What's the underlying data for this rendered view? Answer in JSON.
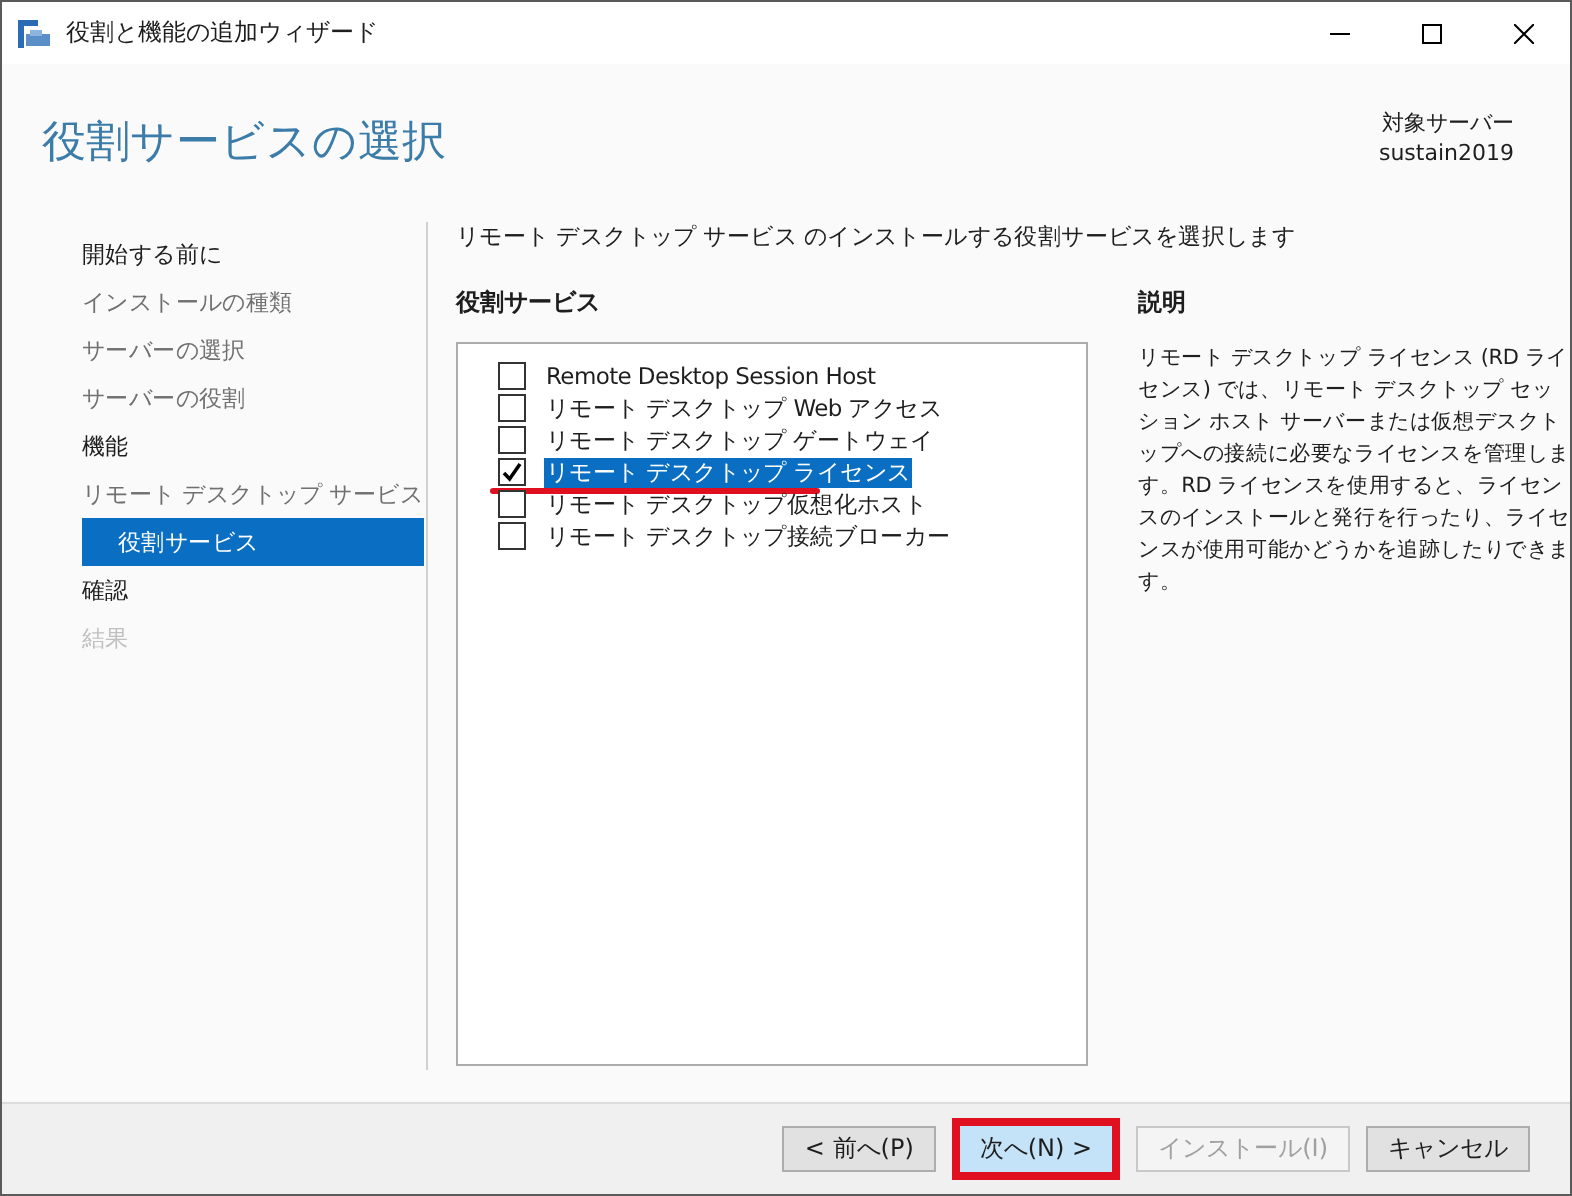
{
  "window": {
    "title": "役割と機能の追加ウィザード"
  },
  "header": {
    "title": "役割サービスの選択",
    "target_label": "対象サーバー",
    "target_server": "sustain2019"
  },
  "sidebar": {
    "items": [
      {
        "label": "開始する前に",
        "selected": false,
        "dimmed": false,
        "disabled": false
      },
      {
        "label": "インストールの種類",
        "selected": false,
        "dimmed": true,
        "disabled": false
      },
      {
        "label": "サーバーの選択",
        "selected": false,
        "dimmed": true,
        "disabled": false
      },
      {
        "label": "サーバーの役割",
        "selected": false,
        "dimmed": true,
        "disabled": false
      },
      {
        "label": "機能",
        "selected": false,
        "dimmed": false,
        "disabled": false
      },
      {
        "label": "リモート デスクトップ サービス",
        "selected": false,
        "dimmed": true,
        "disabled": false,
        "children": [
          {
            "label": "役割サービス",
            "selected": true
          }
        ]
      },
      {
        "label": "確認",
        "selected": false,
        "dimmed": false,
        "disabled": false
      },
      {
        "label": "結果",
        "selected": false,
        "dimmed": false,
        "disabled": true
      }
    ]
  },
  "instruction": "リモート デスクトップ サービス のインストールする役割サービスを選択します",
  "role_services": {
    "heading": "役割サービス",
    "items": [
      {
        "label": "Remote Desktop Session Host",
        "checked": false,
        "selected": false,
        "underlined": false
      },
      {
        "label": "リモート デスクトップ Web アクセス",
        "checked": false,
        "selected": false,
        "underlined": false
      },
      {
        "label": "リモート デスクトップ ゲートウェイ",
        "checked": false,
        "selected": false,
        "underlined": false
      },
      {
        "label": "リモート デスクトップ ライセンス",
        "checked": true,
        "selected": true,
        "underlined": true
      },
      {
        "label": "リモート デスクトップ仮想化ホスト",
        "checked": false,
        "selected": false,
        "underlined": false
      },
      {
        "label": "リモート デスクトップ接続ブローカー",
        "checked": false,
        "selected": false,
        "underlined": false
      }
    ]
  },
  "description": {
    "heading": "説明",
    "text": "リモート デスクトップ ライセンス (RD ライセンス) では、リモート デスクトップ セッション ホスト サーバーまたは仮想デスクトップへの接続に必要なライセンスを管理します。RD ライセンスを使用すると、ライセンスのインストールと発行を行ったり、ライセンスが使用可能かどうかを追跡したりできます。"
  },
  "buttons": [
    {
      "label": "< 前へ(P)",
      "disabled": false,
      "default": false,
      "highlighted": false
    },
    {
      "label": "次へ(N) >",
      "disabled": false,
      "default": true,
      "highlighted": true
    },
    {
      "label": "インストール(I)",
      "disabled": true,
      "default": false,
      "highlighted": false
    },
    {
      "label": "キャンセル",
      "disabled": false,
      "default": false,
      "highlighted": false
    }
  ]
}
